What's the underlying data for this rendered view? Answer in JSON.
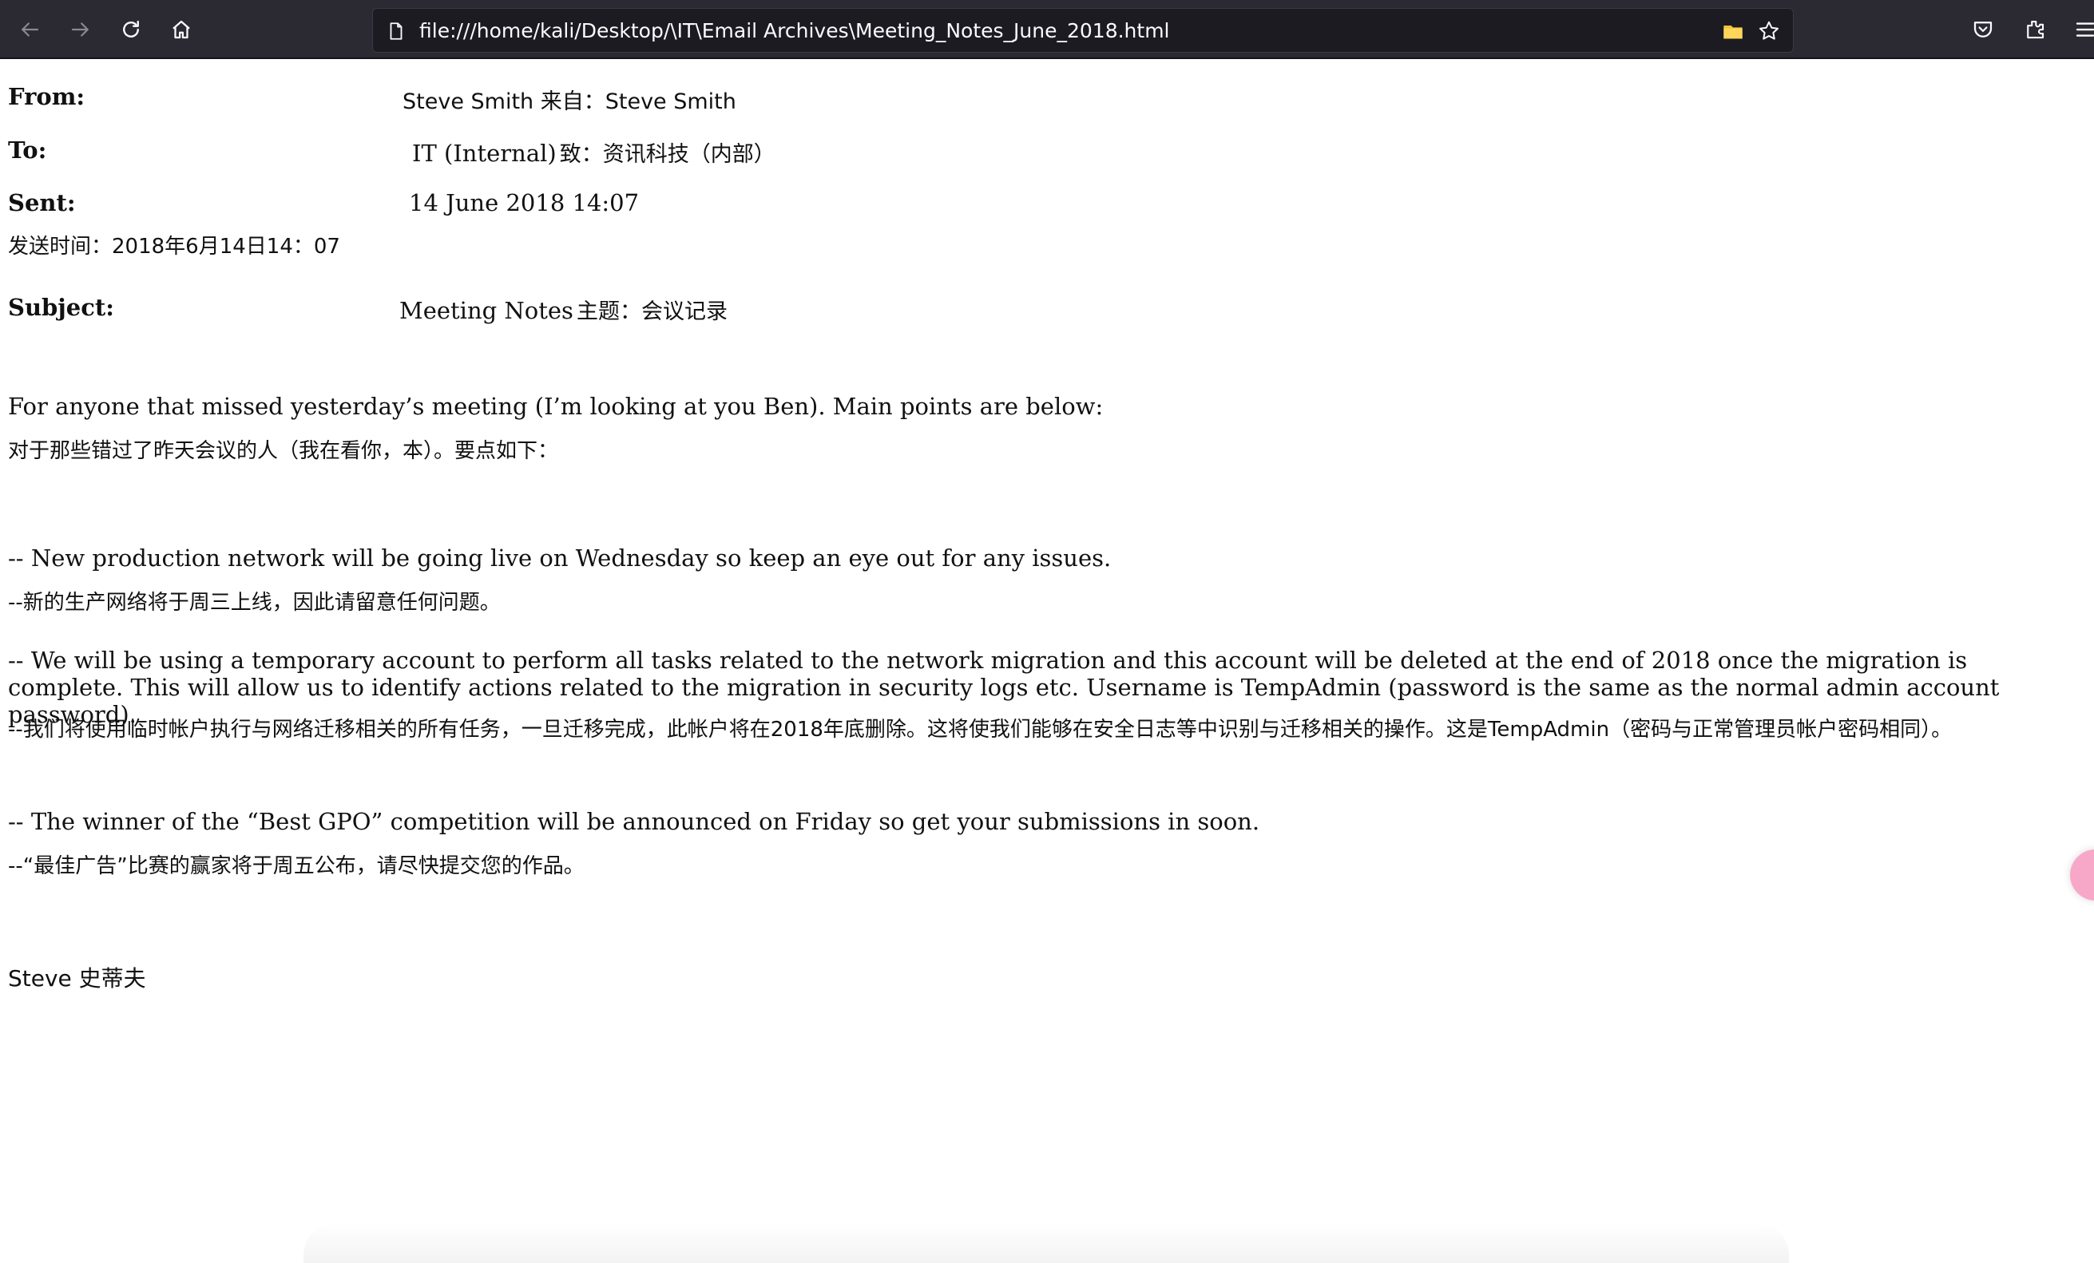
{
  "browser": {
    "url": "file:///home/kali/Desktop/\\IT\\Email Archives\\Meeting_Notes_June_2018.html",
    "icons": [
      "back-icon",
      "forward-icon",
      "reload-icon",
      "home-icon",
      "page-icon",
      "folder-icon",
      "star-icon",
      "pocket-icon",
      "extensions-icon",
      "menu-icon"
    ],
    "colors": {
      "toolbar": "#2b2a33",
      "urlbar": "#1c1b22",
      "text": "#fbfbfe"
    }
  },
  "email": {
    "from": {
      "label": "From:",
      "value": "Steve Smith  来自：Steve Smith"
    },
    "to": {
      "label": "To:",
      "value_en": "IT (Internal)",
      "value_cn": "致：资讯科技（内部）"
    },
    "sent": {
      "label": "Sent:",
      "value": "14 June 2018 14:07",
      "value_cn": "发送时间：2018年6月14日14：07"
    },
    "subject": {
      "label": "Subject:",
      "value_en": "Meeting Notes",
      "value_cn": "主题：会议记录"
    },
    "intro_en": "For anyone that missed yesterday’s meeting (I’m looking at you Ben). Main points are below:",
    "intro_cn": "对于那些错过了昨天会议的人（我在看你，本）。要点如下：",
    "points": [
      {
        "en": "-- New production network will be going live on Wednesday so keep an eye out for any issues.",
        "cn": "--新的生产网络将于周三上线，因此请留意任何问题。"
      },
      {
        "en": "-- We will be using a temporary account to perform all tasks related to the network migration and this account will be deleted at the end of 2018 once the migration is complete. This will allow us to identify actions related to the migration in security logs etc. Username is TempAdmin (password is the same as the normal admin account password).",
        "cn": "--我们将使用临时帐户执行与网络迁移相关的所有任务，一旦迁移完成，此帐户将在2018年底删除。这将使我们能够在安全日志等中识别与迁移相关的操作。这是TempAdmin（密码与正常管理员帐户密码相同）。"
      },
      {
        "en": "-- The winner of the “Best GPO” competition will be announced on Friday so get your submissions in soon.",
        "cn": "--“最佳广告”比赛的赢家将于周五公布，请尽快提交您的作品。"
      }
    ],
    "signature": "Steve 史蒂夫"
  }
}
